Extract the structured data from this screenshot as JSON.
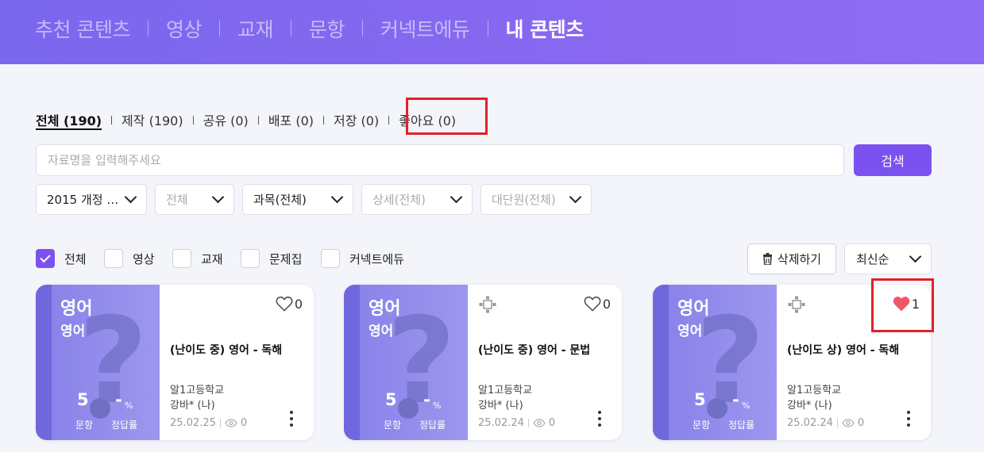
{
  "nav": {
    "tabs": [
      {
        "label": "추천 콘텐츠",
        "active": false
      },
      {
        "label": "영상",
        "active": false
      },
      {
        "label": "교재",
        "active": false
      },
      {
        "label": "문항",
        "active": false
      },
      {
        "label": "커넥트에듀",
        "active": false
      },
      {
        "label": "내 콘텐츠",
        "active": true
      }
    ]
  },
  "filter_tabs": [
    {
      "label": "전체 (190)",
      "active": true
    },
    {
      "label": "제작 (190)",
      "active": false
    },
    {
      "label": "공유 (0)",
      "active": false
    },
    {
      "label": "배포 (0)",
      "active": false
    },
    {
      "label": "저장 (0)",
      "active": false
    },
    {
      "label": "좋아요 (0)",
      "active": false
    }
  ],
  "search": {
    "placeholder": "자료명을 입력해주세요",
    "value": "",
    "button": "검색"
  },
  "dropdowns": [
    {
      "label": "2015 개정 …",
      "disabled": false
    },
    {
      "label": "전체",
      "disabled": true
    },
    {
      "label": "과목(전체)",
      "disabled": false
    },
    {
      "label": "상세(전체)",
      "disabled": true
    },
    {
      "label": "대단원(전체)",
      "disabled": true
    }
  ],
  "type_filters": [
    {
      "label": "전체",
      "checked": true
    },
    {
      "label": "영상",
      "checked": false
    },
    {
      "label": "교재",
      "checked": false
    },
    {
      "label": "문제집",
      "checked": false
    },
    {
      "label": "커넥트에듀",
      "checked": false
    }
  ],
  "delete_button": "삭제하기",
  "sort": {
    "selected": "최신순"
  },
  "cards": [
    {
      "subject": "영어",
      "sub_subject": "영어",
      "question_count": "5",
      "correct_rate": "-",
      "rate_unit": "%",
      "question_label": "문항",
      "rate_label": "정답률",
      "title": "(난이도 중) 영어 - 독해",
      "school": "알1고등학교",
      "author": "강바* (나)",
      "date": "25.02.25",
      "views": "0",
      "likes": "0",
      "liked": false,
      "shared": false
    },
    {
      "subject": "영어",
      "sub_subject": "영어",
      "question_count": "5",
      "correct_rate": "-",
      "rate_unit": "%",
      "question_label": "문항",
      "rate_label": "정답률",
      "title": "(난이도 중) 영어 - 문법",
      "school": "알1고등학교",
      "author": "강바* (나)",
      "date": "25.02.24",
      "views": "0",
      "likes": "0",
      "liked": false,
      "shared": true
    },
    {
      "subject": "영어",
      "sub_subject": "영어",
      "question_count": "5",
      "correct_rate": "-",
      "rate_unit": "%",
      "question_label": "문항",
      "rate_label": "정답률",
      "title": "(난이도 상) 영어 - 독해",
      "school": "알1고등학교",
      "author": "강바* (나)",
      "date": "25.02.24",
      "views": "0",
      "likes": "1",
      "liked": true,
      "shared": true
    }
  ],
  "colors": {
    "accent": "#7b52f0",
    "highlight": "#e0222a",
    "heart": "#f0566a"
  }
}
